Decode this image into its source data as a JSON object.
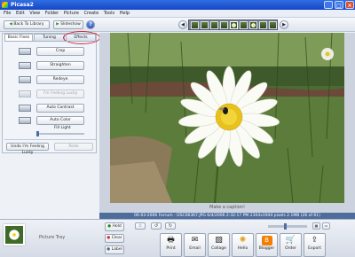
{
  "app": {
    "title": "Picasa2"
  },
  "menu": [
    "File",
    "Edit",
    "View",
    "Folder",
    "Picture",
    "Create",
    "Tools",
    "Help"
  ],
  "toolbar": {
    "back": "Back To Library",
    "slideshow": "Slideshow",
    "help": "?"
  },
  "tabs": [
    "Basic Fixes",
    "Tuning",
    "Effects"
  ],
  "fixes": [
    "Crop",
    "Straighten",
    "Redeye",
    "I'm Feeling Lucky",
    "Auto Contrast",
    "Auto Color",
    "Fill Light"
  ],
  "undo": "Undo I'm Feeling Lucky",
  "redo": "Redo",
  "caption": "Make a caption!",
  "status": "06-03-2006 Ferrum - DSC06367.JPG   6/4/2006 2:32:17 PM   2304x1944 pixels   2.1MB   (26 of 61)",
  "tray": {
    "label": "Picture Tray",
    "hold": "Hold",
    "clear": "Clear",
    "label_btn": "Label"
  },
  "exports": [
    "Print",
    "Email",
    "Collage",
    "Hello",
    "Blogger",
    "Order",
    "Export"
  ],
  "colors": {
    "accent": "#1f5bd6",
    "highlight": "#d9253b"
  }
}
